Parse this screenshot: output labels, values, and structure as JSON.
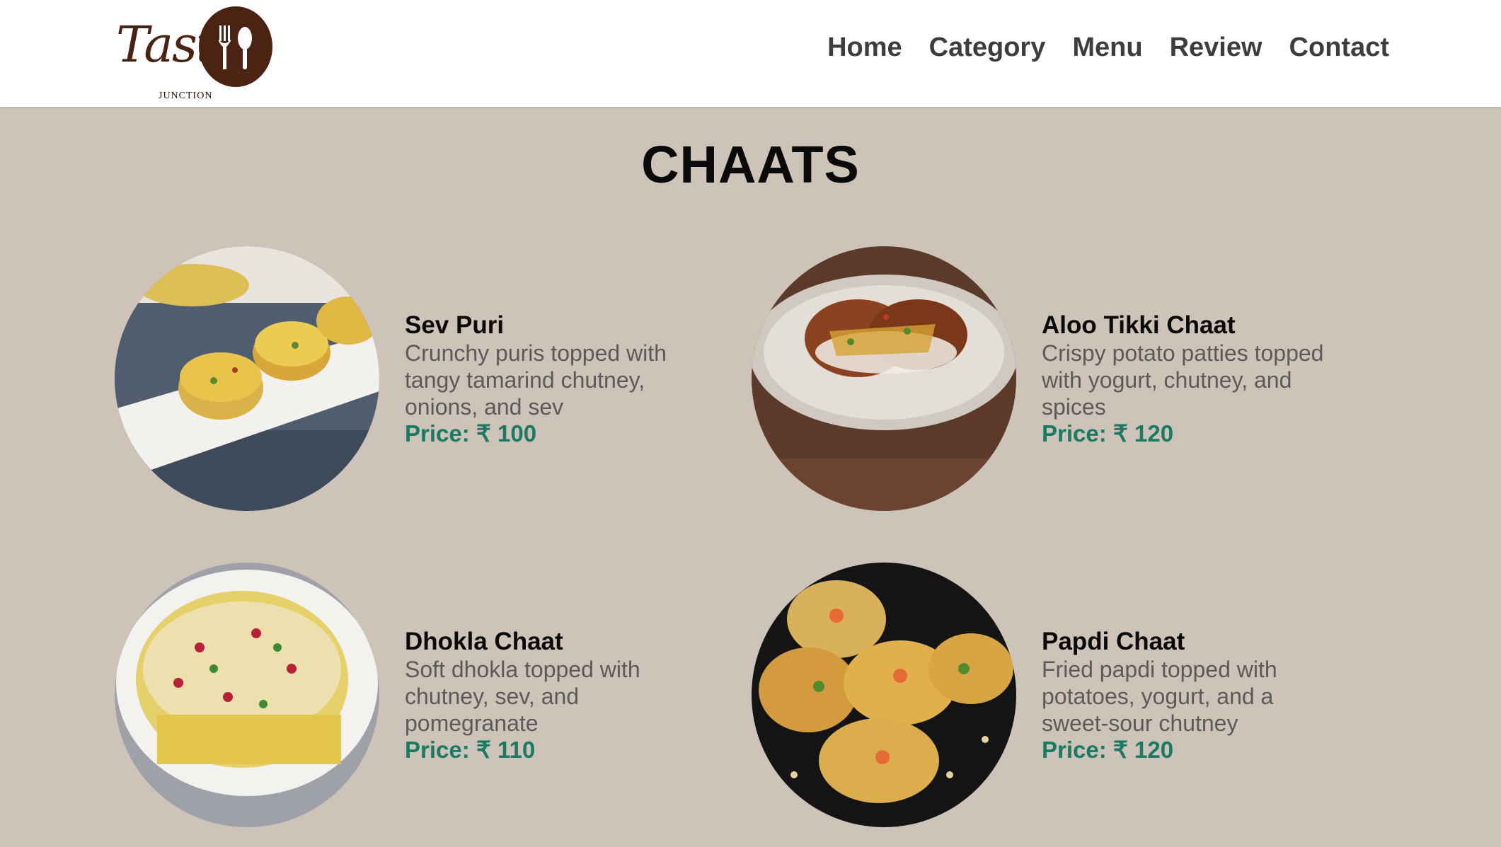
{
  "brand": {
    "logo_script": "Taste",
    "logo_sub": "JUNCTION",
    "colors": {
      "primary": "#4a2313",
      "circle": "#4a2313"
    }
  },
  "nav": {
    "items": [
      {
        "label": "Home"
      },
      {
        "label": "Category"
      },
      {
        "label": "Menu"
      },
      {
        "label": "Review"
      },
      {
        "label": "Contact"
      }
    ]
  },
  "page": {
    "title": "CHAATS",
    "background_color": "#cec3b8",
    "price_color": "#1b7a63"
  },
  "items": [
    {
      "name": "Sev Puri",
      "description": "Crunchy puris topped with tangy tamarind chutney, onions, and sev",
      "price": "Price: ₹ 100",
      "image": "sev-puri-photo"
    },
    {
      "name": "Aloo Tikki Chaat",
      "description": "Crispy potato patties topped with yogurt, chutney, and spices",
      "price": "Price: ₹ 120",
      "image": "aloo-tikki-photo"
    },
    {
      "name": "Dhokla Chaat",
      "description": "Soft dhokla topped with chutney, sev, and pomegranate",
      "price": "Price: ₹ 110",
      "image": "dhokla-chaat-photo"
    },
    {
      "name": "Papdi Chaat",
      "description": "Fried papdi topped with potatoes, yogurt, and a sweet-sour chutney",
      "price": "Price: ₹ 120",
      "image": "papdi-chaat-photo"
    }
  ]
}
